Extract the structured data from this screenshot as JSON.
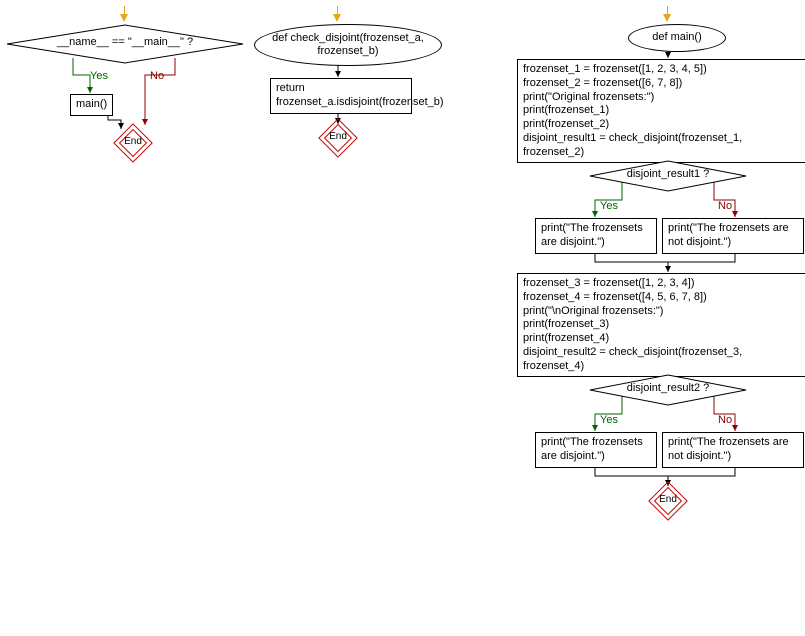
{
  "flowchart1": {
    "decision": "__name__ == \"__main__\" ?",
    "yes_label": "Yes",
    "no_label": "No",
    "yes_action": "main()",
    "end": "End"
  },
  "flowchart2": {
    "func_def": "def check_disjoint(frozenset_a, frozenset_b)",
    "body": "return frozenset_a.isdisjoint(frozenset_b)",
    "end": "End"
  },
  "flowchart3": {
    "func_def": "def main()",
    "block1_lines": [
      "frozenset_1 = frozenset([1, 2, 3, 4, 5])",
      "frozenset_2 = frozenset([6, 7, 8])",
      "print(\"Original frozensets:\")",
      "print(frozenset_1)",
      "print(frozenset_2)",
      "disjoint_result1 = check_disjoint(frozenset_1, frozenset_2)"
    ],
    "decision1": "disjoint_result1 ?",
    "yes_label": "Yes",
    "no_label": "No",
    "d1_yes_lines": [
      "print(\"The frozensets",
      "are disjoint.\")"
    ],
    "d1_no_lines": [
      "print(\"The frozensets are",
      "not disjoint.\")"
    ],
    "block2_lines": [
      "frozenset_3 = frozenset([1, 2, 3, 4])",
      "frozenset_4 = frozenset([4, 5, 6, 7, 8])",
      "print(\"\\nOriginal frozensets:\")",
      "print(frozenset_3)",
      "print(frozenset_4)",
      "disjoint_result2 = check_disjoint(frozenset_3, frozenset_4)"
    ],
    "decision2": "disjoint_result2 ?",
    "d2_yes_lines": [
      "print(\"The frozensets",
      "are disjoint.\")"
    ],
    "d2_no_lines": [
      "print(\"The frozensets are",
      "not disjoint.\")"
    ],
    "end": "End"
  },
  "chart_data": {
    "type": "flowchart",
    "charts": [
      {
        "name": "entry",
        "nodes": [
          {
            "id": "d0",
            "type": "decision",
            "text": "__name__ == \"__main__\" ?"
          },
          {
            "id": "a0",
            "type": "process",
            "text": "main()"
          },
          {
            "id": "e0",
            "type": "end",
            "text": "End"
          }
        ],
        "edges": [
          {
            "from": "d0",
            "to": "a0",
            "label": "Yes"
          },
          {
            "from": "d0",
            "to": "e0",
            "label": "No"
          },
          {
            "from": "a0",
            "to": "e0"
          }
        ]
      },
      {
        "name": "check_disjoint",
        "nodes": [
          {
            "id": "f1",
            "type": "function",
            "text": "def check_disjoint(frozenset_a, frozenset_b)"
          },
          {
            "id": "b1",
            "type": "process",
            "text": "return frozenset_a.isdisjoint(frozenset_b)"
          },
          {
            "id": "e1",
            "type": "end",
            "text": "End"
          }
        ],
        "edges": [
          {
            "from": "f1",
            "to": "b1"
          },
          {
            "from": "b1",
            "to": "e1"
          }
        ]
      },
      {
        "name": "main",
        "nodes": [
          {
            "id": "f2",
            "type": "function",
            "text": "def main()"
          },
          {
            "id": "b2",
            "type": "process",
            "text": "frozenset_1 = frozenset([1, 2, 3, 4, 5]); frozenset_2 = frozenset([6, 7, 8]); print(\"Original frozensets:\"); print(frozenset_1); print(frozenset_2); disjoint_result1 = check_disjoint(frozenset_1, frozenset_2)"
          },
          {
            "id": "d2a",
            "type": "decision",
            "text": "disjoint_result1 ?"
          },
          {
            "id": "y2a",
            "type": "process",
            "text": "print(\"The frozensets are disjoint.\")"
          },
          {
            "id": "n2a",
            "type": "process",
            "text": "print(\"The frozensets are not disjoint.\")"
          },
          {
            "id": "b2b",
            "type": "process",
            "text": "frozenset_3 = frozenset([1, 2, 3, 4]); frozenset_4 = frozenset([4, 5, 6, 7, 8]); print(\"\\nOriginal frozensets:\"); print(frozenset_3); print(frozenset_4); disjoint_result2 = check_disjoint(frozenset_3, frozenset_4)"
          },
          {
            "id": "d2b",
            "type": "decision",
            "text": "disjoint_result2 ?"
          },
          {
            "id": "y2b",
            "type": "process",
            "text": "print(\"The frozensets are disjoint.\")"
          },
          {
            "id": "n2b",
            "type": "process",
            "text": "print(\"The frozensets are not disjoint.\")"
          },
          {
            "id": "e2",
            "type": "end",
            "text": "End"
          }
        ],
        "edges": [
          {
            "from": "f2",
            "to": "b2"
          },
          {
            "from": "b2",
            "to": "d2a"
          },
          {
            "from": "d2a",
            "to": "y2a",
            "label": "Yes"
          },
          {
            "from": "d2a",
            "to": "n2a",
            "label": "No"
          },
          {
            "from": "y2a",
            "to": "b2b"
          },
          {
            "from": "n2a",
            "to": "b2b"
          },
          {
            "from": "b2b",
            "to": "d2b"
          },
          {
            "from": "d2b",
            "to": "y2b",
            "label": "Yes"
          },
          {
            "from": "d2b",
            "to": "n2b",
            "label": "No"
          },
          {
            "from": "y2b",
            "to": "e2"
          },
          {
            "from": "n2b",
            "to": "e2"
          }
        ]
      }
    ]
  }
}
